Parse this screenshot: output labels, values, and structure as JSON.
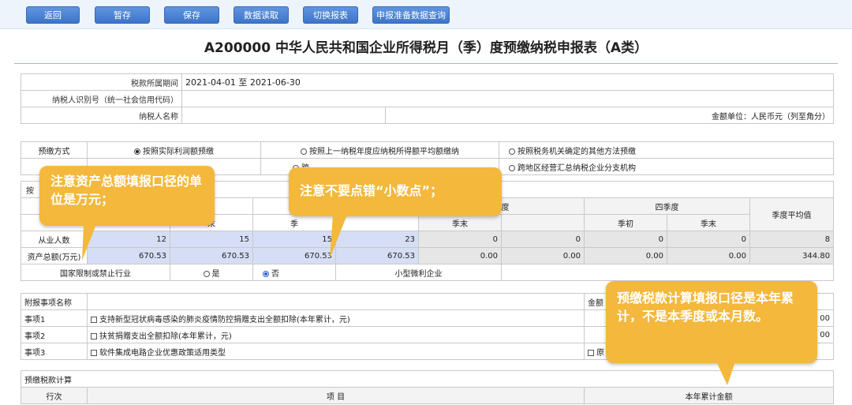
{
  "toolbar": {
    "back": "返回",
    "save_temp": "暂存",
    "save": "保存",
    "read_data": "数据读取",
    "switch_form": "切换报表",
    "query": "申报准备数据查询"
  },
  "title": "A200000  中华人民共和国企业所得税月（季）度预缴纳税申报表（A类）",
  "info": {
    "period_label": "税款所属期间",
    "period_value": "2021-04-01  至  2021-06-30",
    "taxpayer_id_label": "纳税人识别号（统一社会信用代码）",
    "taxpayer_id_value": "",
    "taxpayer_name_label": "纳税人名称",
    "taxpayer_name_value": "",
    "unit": "金额单位：人民币元（列至角分）"
  },
  "prepay": {
    "label": "预缴方式",
    "options": [
      "按照实际利润额预缴",
      "按照上一纳税年度应纳税所得额平均额缴纳",
      "按照税务机关确定的其他方法预缴"
    ],
    "row2_options": [
      "跨",
      "跨地区经营汇总纳税企业分支机构"
    ],
    "row2_label": "",
    "row3_label": "按"
  },
  "quarters": {
    "q3": "季度",
    "q4": "四季度",
    "q_start": "季初",
    "q_end": "季末",
    "q_end_a": "末",
    "q_start_b": "季",
    "avg": "季度平均值"
  },
  "employees": {
    "label": "从业人数",
    "values": [
      "12",
      "15",
      "15",
      "23",
      "0",
      "0",
      "0",
      "0",
      "8"
    ]
  },
  "assets": {
    "label": "资产总额(万元)",
    "values": [
      "670.53",
      "670.53",
      "670.53",
      "670.53",
      "0.00",
      "0.00",
      "0.00",
      "0.00",
      "344.80"
    ]
  },
  "industry": {
    "label": "国家限制或禁止行业",
    "yes": "是",
    "no": "否",
    "small_label": "小型微利企业"
  },
  "items": {
    "header": "附报事项名称",
    "amount_header": "金额",
    "rows": [
      {
        "no": "事项1",
        "text": "支持新型冠状病毒感染的肺炎疫情防控捐赠支出全额扣除(本年累计，元)",
        "amount": "00"
      },
      {
        "no": "事项2",
        "text": "扶贫捐赠支出全额扣除(本年累计，元)",
        "amount": "00"
      },
      {
        "no": "事项3",
        "text": "软件集成电路企业优惠政策适用类型",
        "amount": "原"
      }
    ]
  },
  "calc": {
    "title": "预缴税款计算",
    "col_row": "行次",
    "col_item": "项          目",
    "col_amount": "本年累计金额"
  },
  "callouts": {
    "assets_unit": "注意资产总额填报口径的单位是万元；",
    "decimal": "注意不要点错“小数点”；",
    "tax_calc": "预缴税款计算填报口径是本年累计，不是本季度或本月数。"
  }
}
